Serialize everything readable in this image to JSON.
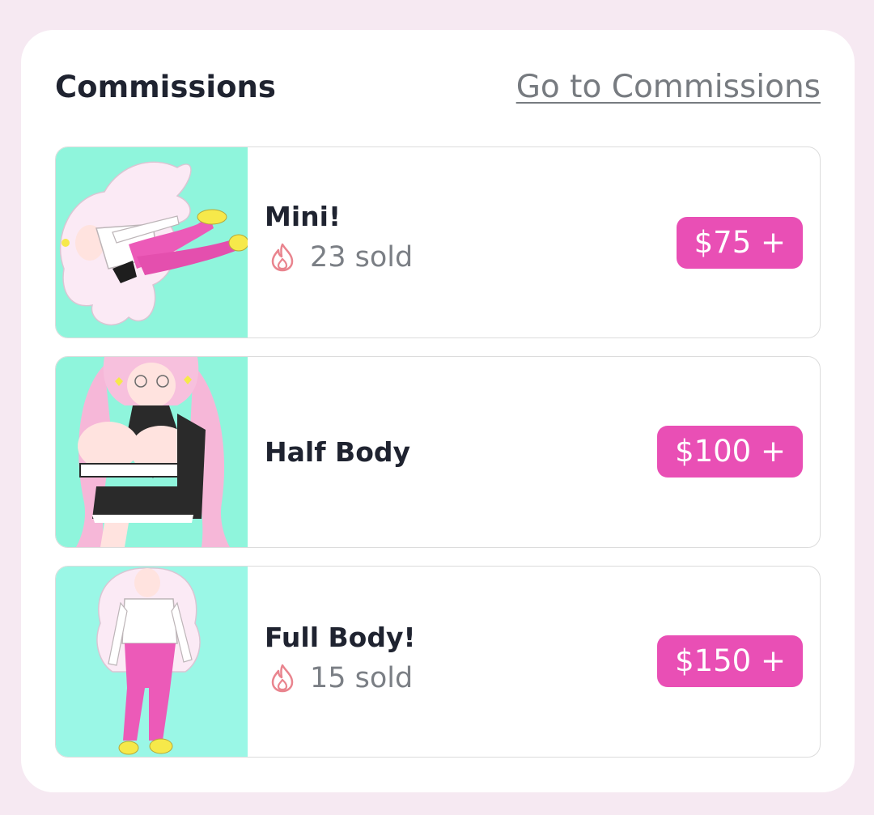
{
  "section": {
    "title": "Commissions",
    "link_label": "Go to Commissions"
  },
  "icons": {
    "sold": "flame-icon"
  },
  "colors": {
    "accent": "#e94fb5",
    "thumb_background": "#8ff5dc"
  },
  "items": [
    {
      "name": "Mini!",
      "sold": "23 sold",
      "price": "$75 +"
    },
    {
      "name": "Half Body",
      "price": "$100 +"
    },
    {
      "name": "Full Body!",
      "sold": "15 sold",
      "price": "$150 +"
    }
  ]
}
